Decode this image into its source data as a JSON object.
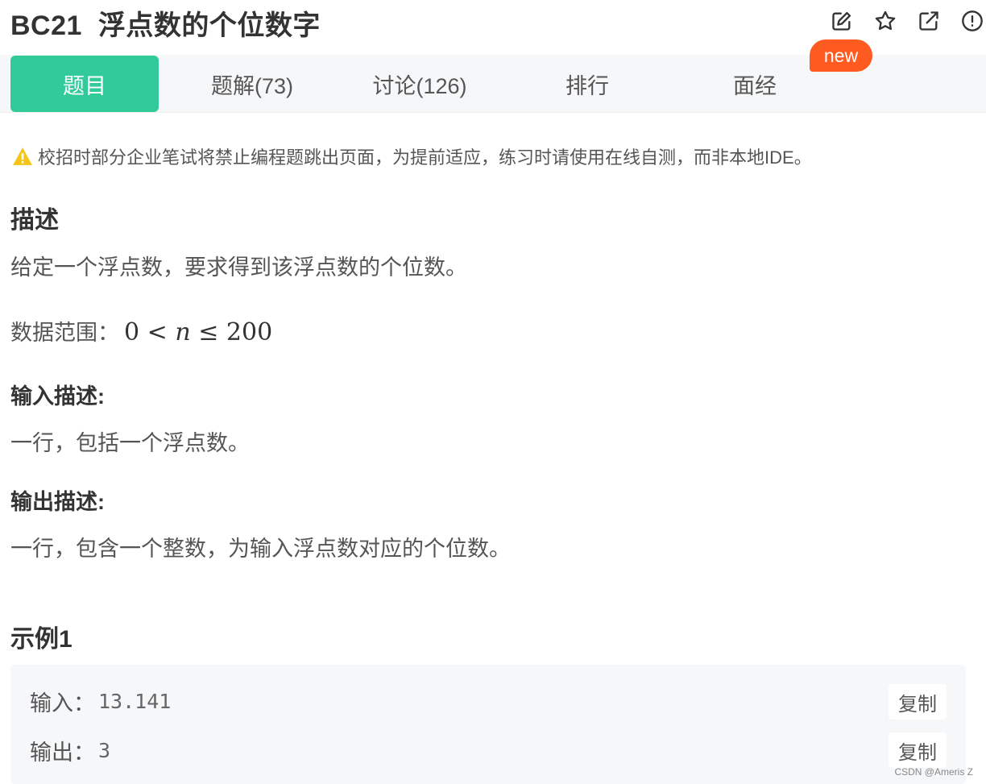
{
  "header": {
    "code": "BC21",
    "title": "浮点数的个位数字",
    "icons": [
      "edit-icon",
      "star-icon",
      "share-icon",
      "report-icon"
    ]
  },
  "tabs": [
    {
      "label": "题目",
      "active": true
    },
    {
      "label": "题解(73)",
      "active": false
    },
    {
      "label": "讨论(126)",
      "active": false
    },
    {
      "label": "排行",
      "active": false
    },
    {
      "label": "面经",
      "active": false
    }
  ],
  "badge": "new",
  "notice": "校招时部分企业笔试将禁止编程题跳出页面，为提前适应，练习时请使用在线自测，而非本地IDE。",
  "description": {
    "heading": "描述",
    "text": "给定一个浮点数，要求得到该浮点数的个位数。",
    "range_label": "数据范围：",
    "range_expr": {
      "lower": "0",
      "op1": "<",
      "var": "n",
      "op2": "≤",
      "upper": "200"
    }
  },
  "input": {
    "heading": "输入描述:",
    "text": "一行，包括一个浮点数。"
  },
  "output": {
    "heading": "输出描述:",
    "text": "一行，包含一个整数，为输入浮点数对应的个位数。"
  },
  "example": {
    "heading": "示例1",
    "input_label": "输入：",
    "input_value": "13.141",
    "output_label": "输出：",
    "output_value": "3",
    "copy_label": "复制"
  },
  "watermark": "CSDN @Ameris Z",
  "colors": {
    "accent": "#32ca99",
    "badge": "#ff5a1f",
    "warning": "#f5c518"
  }
}
